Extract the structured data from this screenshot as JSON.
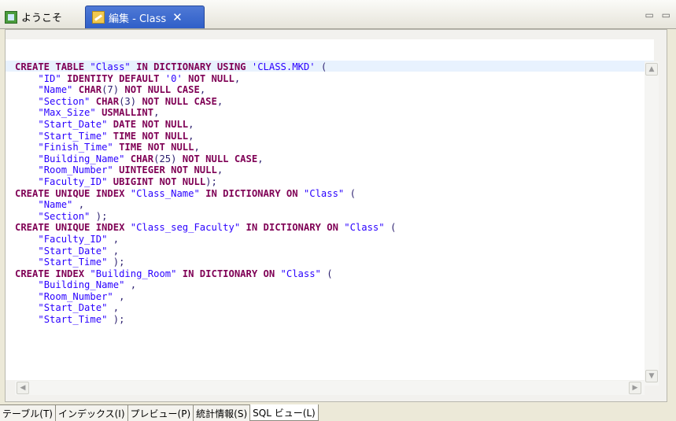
{
  "tabs": {
    "welcome_label": "ようこそ",
    "edit_label": "編集 - Class",
    "close_glyph": "✕"
  },
  "window_controls": "▭ ▭",
  "sql_lines": [
    [
      {
        "t": "kw",
        "v": "CREATE TABLE "
      },
      {
        "t": "str",
        "v": "\"Class\""
      },
      {
        "t": "kw",
        "v": " IN DICTIONARY USING "
      },
      {
        "t": "str",
        "v": "'CLASS.MKD'"
      },
      {
        "t": "p",
        "v": " ("
      }
    ],
    [
      {
        "t": "p",
        "v": "    "
      },
      {
        "t": "str",
        "v": "\"ID\""
      },
      {
        "t": "kw",
        "v": " IDENTITY DEFAULT "
      },
      {
        "t": "str",
        "v": "'0'"
      },
      {
        "t": "kw",
        "v": " NOT NULL"
      },
      {
        "t": "p",
        "v": ","
      }
    ],
    [
      {
        "t": "p",
        "v": "    "
      },
      {
        "t": "str",
        "v": "\"Name\""
      },
      {
        "t": "kw",
        "v": " CHAR"
      },
      {
        "t": "p",
        "v": "(7)"
      },
      {
        "t": "kw",
        "v": " NOT NULL CASE"
      },
      {
        "t": "p",
        "v": ","
      }
    ],
    [
      {
        "t": "p",
        "v": "    "
      },
      {
        "t": "str",
        "v": "\"Section\""
      },
      {
        "t": "kw",
        "v": " CHAR"
      },
      {
        "t": "p",
        "v": "(3)"
      },
      {
        "t": "kw",
        "v": " NOT NULL CASE"
      },
      {
        "t": "p",
        "v": ","
      }
    ],
    [
      {
        "t": "p",
        "v": "    "
      },
      {
        "t": "str",
        "v": "\"Max_Size\""
      },
      {
        "t": "kw",
        "v": " USMALLINT"
      },
      {
        "t": "p",
        "v": ","
      }
    ],
    [
      {
        "t": "p",
        "v": "    "
      },
      {
        "t": "str",
        "v": "\"Start_Date\""
      },
      {
        "t": "kw",
        "v": " DATE NOT NULL"
      },
      {
        "t": "p",
        "v": ","
      }
    ],
    [
      {
        "t": "p",
        "v": "    "
      },
      {
        "t": "str",
        "v": "\"Start_Time\""
      },
      {
        "t": "kw",
        "v": " TIME NOT NULL"
      },
      {
        "t": "p",
        "v": ","
      }
    ],
    [
      {
        "t": "p",
        "v": "    "
      },
      {
        "t": "str",
        "v": "\"Finish_Time\""
      },
      {
        "t": "kw",
        "v": " TIME NOT NULL"
      },
      {
        "t": "p",
        "v": ","
      }
    ],
    [
      {
        "t": "p",
        "v": "    "
      },
      {
        "t": "str",
        "v": "\"Building_Name\""
      },
      {
        "t": "kw",
        "v": " CHAR"
      },
      {
        "t": "p",
        "v": "(25)"
      },
      {
        "t": "kw",
        "v": " NOT NULL CASE"
      },
      {
        "t": "p",
        "v": ","
      }
    ],
    [
      {
        "t": "p",
        "v": "    "
      },
      {
        "t": "str",
        "v": "\"Room_Number\""
      },
      {
        "t": "kw",
        "v": " UINTEGER NOT NULL"
      },
      {
        "t": "p",
        "v": ","
      }
    ],
    [
      {
        "t": "p",
        "v": "    "
      },
      {
        "t": "str",
        "v": "\"Faculty_ID\""
      },
      {
        "t": "kw",
        "v": " UBIGINT NOT NULL"
      },
      {
        "t": "p",
        "v": ");"
      }
    ],
    [
      {
        "t": "kw",
        "v": "CREATE UNIQUE INDEX "
      },
      {
        "t": "str",
        "v": "\"Class_Name\""
      },
      {
        "t": "kw",
        "v": " IN DICTIONARY ON "
      },
      {
        "t": "str",
        "v": "\"Class\""
      },
      {
        "t": "p",
        "v": " ("
      }
    ],
    [
      {
        "t": "p",
        "v": "    "
      },
      {
        "t": "str",
        "v": "\"Name\""
      },
      {
        "t": "p",
        "v": " ,"
      }
    ],
    [
      {
        "t": "p",
        "v": "    "
      },
      {
        "t": "str",
        "v": "\"Section\""
      },
      {
        "t": "p",
        "v": " );"
      }
    ],
    [
      {
        "t": "kw",
        "v": "CREATE UNIQUE INDEX "
      },
      {
        "t": "str",
        "v": "\"Class_seg_Faculty\""
      },
      {
        "t": "kw",
        "v": " IN DICTIONARY ON "
      },
      {
        "t": "str",
        "v": "\"Class\""
      },
      {
        "t": "p",
        "v": " ("
      }
    ],
    [
      {
        "t": "p",
        "v": "    "
      },
      {
        "t": "str",
        "v": "\"Faculty_ID\""
      },
      {
        "t": "p",
        "v": " ,"
      }
    ],
    [
      {
        "t": "p",
        "v": "    "
      },
      {
        "t": "str",
        "v": "\"Start_Date\""
      },
      {
        "t": "p",
        "v": " ,"
      }
    ],
    [
      {
        "t": "p",
        "v": "    "
      },
      {
        "t": "str",
        "v": "\"Start_Time\""
      },
      {
        "t": "p",
        "v": " );"
      }
    ],
    [
      {
        "t": "kw",
        "v": "CREATE INDEX "
      },
      {
        "t": "str",
        "v": "\"Building_Room\""
      },
      {
        "t": "kw",
        "v": " IN DICTIONARY ON "
      },
      {
        "t": "str",
        "v": "\"Class\""
      },
      {
        "t": "p",
        "v": " ("
      }
    ],
    [
      {
        "t": "p",
        "v": "    "
      },
      {
        "t": "str",
        "v": "\"Building_Name\""
      },
      {
        "t": "p",
        "v": " ,"
      }
    ],
    [
      {
        "t": "p",
        "v": "    "
      },
      {
        "t": "str",
        "v": "\"Room_Number\""
      },
      {
        "t": "p",
        "v": " ,"
      }
    ],
    [
      {
        "t": "p",
        "v": "    "
      },
      {
        "t": "str",
        "v": "\"Start_Date\""
      },
      {
        "t": "p",
        "v": " ,"
      }
    ],
    [
      {
        "t": "p",
        "v": "    "
      },
      {
        "t": "str",
        "v": "\"Start_Time\""
      },
      {
        "t": "p",
        "v": " );"
      }
    ]
  ],
  "scrollbar": {
    "up": "▲",
    "down": "▼",
    "left": "◀",
    "right": "▶"
  },
  "bottom_tabs": [
    {
      "label": "テーブル(T)",
      "active": false
    },
    {
      "label": "インデックス(I)",
      "active": false
    },
    {
      "label": "プレビュー(P)",
      "active": false
    },
    {
      "label": "統計情報(S)",
      "active": false
    },
    {
      "label": "SQL ビュー(L)",
      "active": true
    }
  ]
}
